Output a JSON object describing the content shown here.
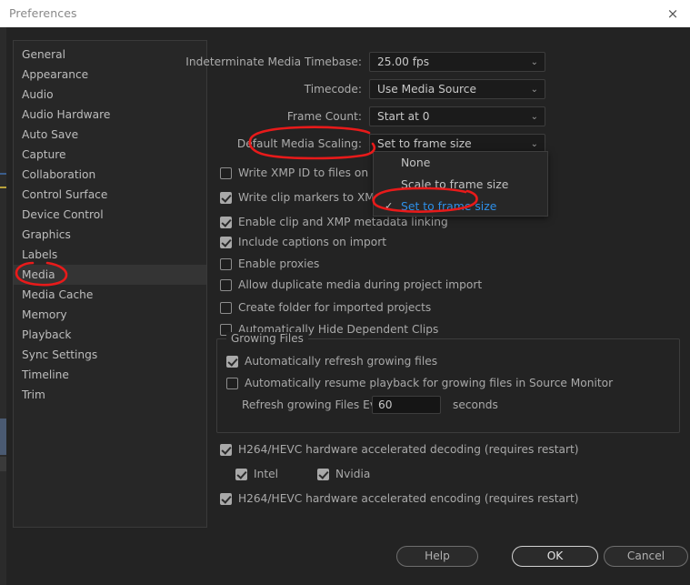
{
  "window": {
    "title": "Preferences",
    "close_icon": "close-icon",
    "close_glyph": "×"
  },
  "sidebar": {
    "items": [
      {
        "label": "General",
        "selected": false
      },
      {
        "label": "Appearance",
        "selected": false
      },
      {
        "label": "Audio",
        "selected": false
      },
      {
        "label": "Audio Hardware",
        "selected": false
      },
      {
        "label": "Auto Save",
        "selected": false
      },
      {
        "label": "Capture",
        "selected": false
      },
      {
        "label": "Collaboration",
        "selected": false
      },
      {
        "label": "Control Surface",
        "selected": false
      },
      {
        "label": "Device Control",
        "selected": false
      },
      {
        "label": "Graphics",
        "selected": false
      },
      {
        "label": "Labels",
        "selected": false
      },
      {
        "label": "Media",
        "selected": true
      },
      {
        "label": "Media Cache",
        "selected": false
      },
      {
        "label": "Memory",
        "selected": false
      },
      {
        "label": "Playback",
        "selected": false
      },
      {
        "label": "Sync Settings",
        "selected": false
      },
      {
        "label": "Timeline",
        "selected": false
      },
      {
        "label": "Trim",
        "selected": false
      }
    ]
  },
  "main": {
    "selects": [
      {
        "label": "Indeterminate Media Timebase:",
        "value": "25.00 fps",
        "chevron": "⌄"
      },
      {
        "label": "Timecode:",
        "value": "Use Media Source",
        "chevron": "⌄"
      },
      {
        "label": "Frame Count:",
        "value": "Start at 0",
        "chevron": "⌄"
      },
      {
        "label": "Default Media Scaling:",
        "value": "Set to frame size",
        "chevron": "⌄"
      }
    ],
    "dropdown_menu": {
      "open": true,
      "tick_glyph": "✓",
      "options": [
        {
          "label": "None",
          "checked": false
        },
        {
          "label": "Scale to frame size",
          "checked": false
        },
        {
          "label": "Set to frame size",
          "checked": true
        }
      ]
    },
    "checkboxes": [
      {
        "label": "Write XMP ID to files on import",
        "checked": false
      },
      {
        "label": "Write clip markers to XMP",
        "checked": true
      },
      {
        "label": "Enable clip and XMP metadata linking",
        "checked": true
      },
      {
        "label": "Include captions on import",
        "checked": true
      },
      {
        "label": "Enable proxies",
        "checked": false
      },
      {
        "label": "Allow duplicate media during project import",
        "checked": false
      },
      {
        "label": "Create folder for imported projects",
        "checked": false
      },
      {
        "label": "Automatically Hide Dependent Clips",
        "checked": false
      }
    ],
    "growing_files": {
      "title": "Growing Files",
      "auto_refresh": {
        "label": "Automatically refresh growing files",
        "checked": true
      },
      "auto_resume": {
        "label": "Automatically resume playback for growing files in Source Monitor",
        "checked": false
      },
      "refresh_label": "Refresh growing Files Every",
      "refresh_value": "60",
      "refresh_unit": "seconds"
    },
    "hardware": {
      "decoding": {
        "label": "H264/HEVC hardware accelerated decoding (requires restart)",
        "checked": true
      },
      "intel": {
        "label": "Intel",
        "checked": true
      },
      "nvidia": {
        "label": "Nvidia",
        "checked": true
      },
      "encoding": {
        "label": "H264/HEVC hardware accelerated encoding (requires restart)",
        "checked": true
      }
    }
  },
  "footer": {
    "help": "Help",
    "ok": "OK",
    "cancel": "Cancel"
  },
  "annotations": {
    "color": "#e81a1a",
    "marks": [
      {
        "name": "circle-default-media-scaling",
        "target": "Default Media Scaling:"
      },
      {
        "name": "circle-sidebar-media",
        "target": "Media"
      },
      {
        "name": "circle-set-to-frame-size-option",
        "target": "Set to frame size"
      }
    ]
  },
  "colors": {
    "window_background": "#232323",
    "panel_background": "#272727",
    "titlebar_background": "#ffffff",
    "selected_row": "#343434",
    "accent_blue": "#2e8fe8",
    "annotation_red": "#e81a1a",
    "text": "#a9a9a9"
  }
}
